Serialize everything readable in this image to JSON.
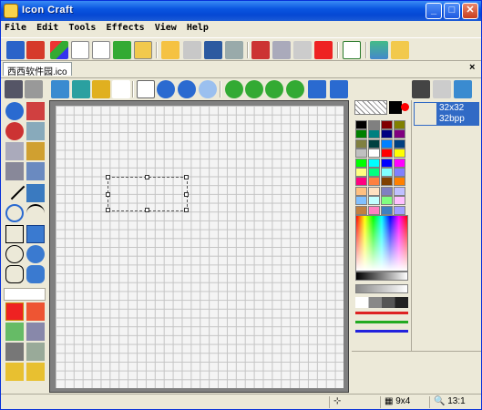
{
  "window": {
    "title": "Icon Craft",
    "minimize": "_",
    "maximize": "□",
    "close": "✕"
  },
  "menu": [
    "File",
    "Edit",
    "Tools",
    "Effects",
    "View",
    "Help"
  ],
  "document_tab": {
    "name": "西西软件园.ico",
    "close": "×"
  },
  "formats": {
    "size": "32x32",
    "depth": "32bpp"
  },
  "status": {
    "selection_size": "9x4",
    "zoom": "13:1"
  },
  "palette": [
    "#000000",
    "#808080",
    "#800000",
    "#808000",
    "#008000",
    "#008080",
    "#000080",
    "#800080",
    "#808040",
    "#004040",
    "#0080ff",
    "#004080",
    "#c0c0c0",
    "#ffffff",
    "#ff0000",
    "#ffff00",
    "#00ff00",
    "#00ffff",
    "#0000ff",
    "#ff00ff",
    "#ffff80",
    "#00ff80",
    "#80ffff",
    "#8080ff",
    "#ff0080",
    "#ff8040",
    "#804000",
    "#ff8000",
    "#ffc080",
    "#ffe0c0",
    "#8080c0",
    "#c0c0ff",
    "#80c0ff",
    "#c0ffff",
    "#80ff80",
    "#ffc0ff",
    "#c08040",
    "#ff80c0",
    "#4080c0",
    "#a0a0ff",
    "#c0ffc0",
    "#e0e0e0"
  ]
}
